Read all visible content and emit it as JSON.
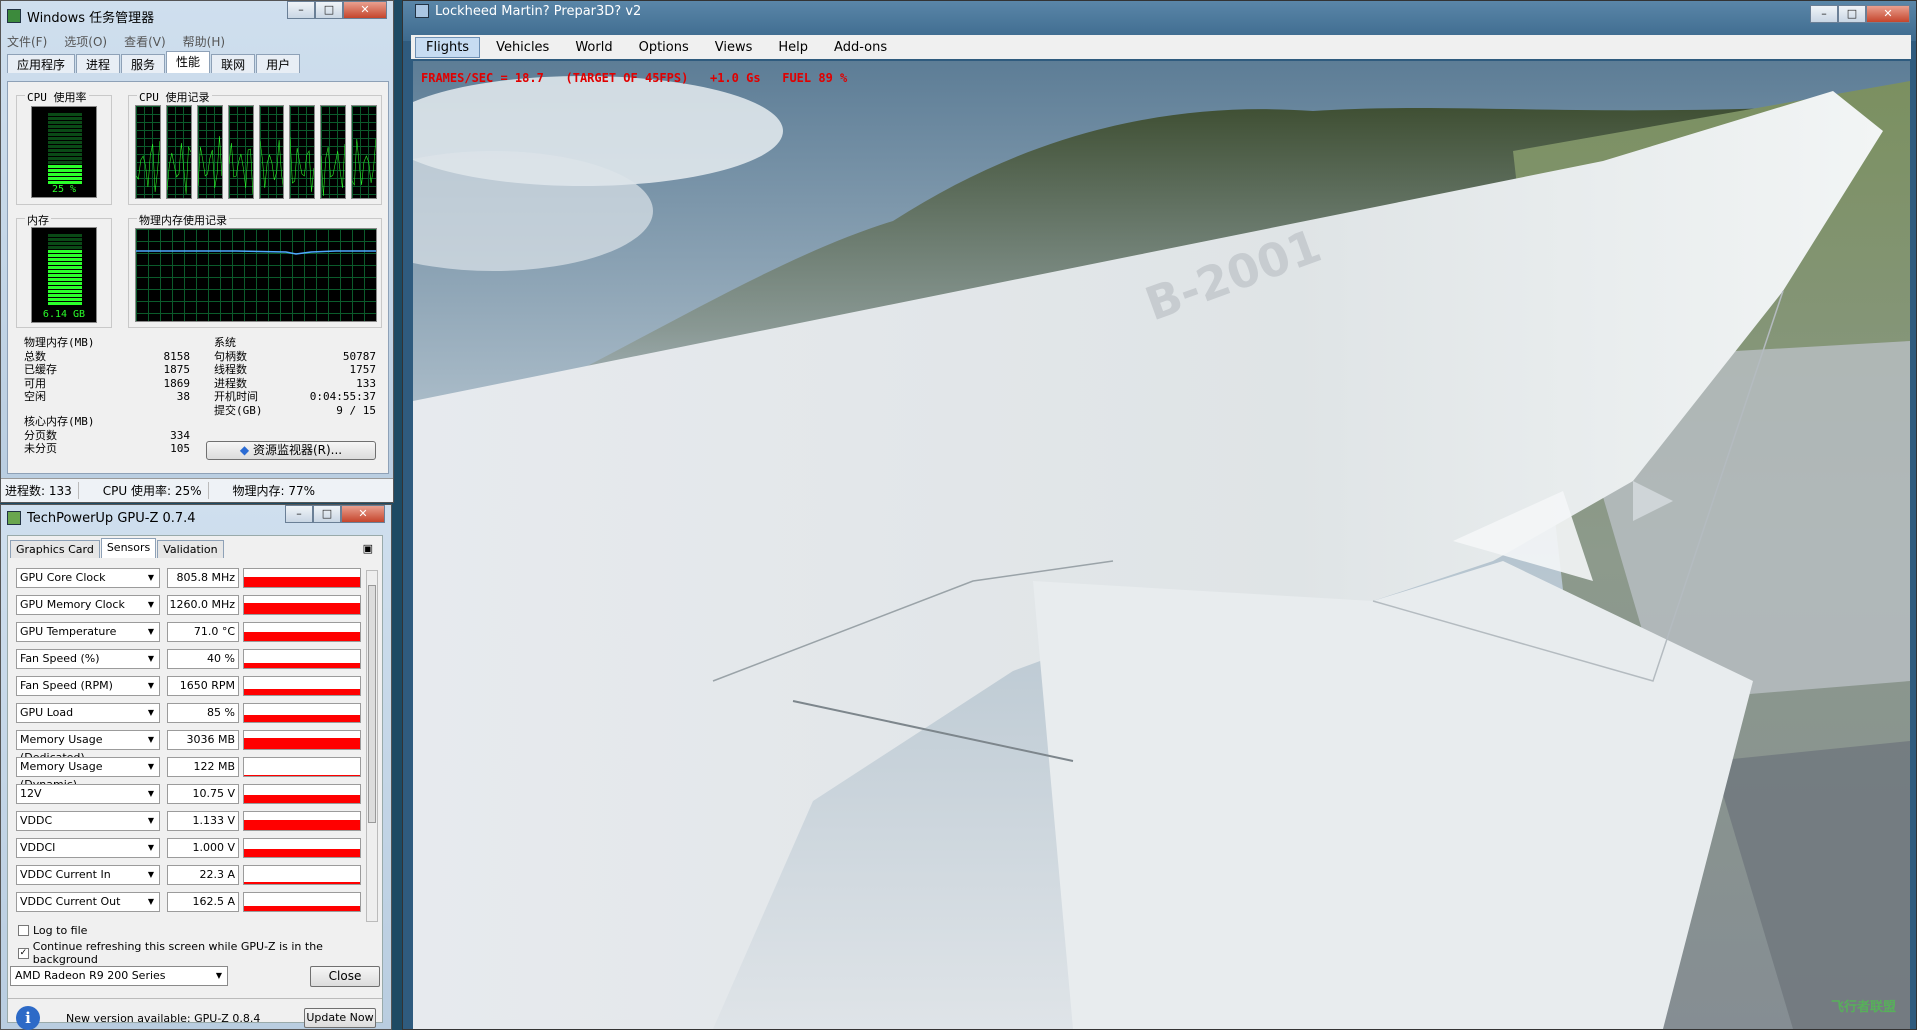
{
  "task_manager": {
    "title": "Windows 任务管理器",
    "menu": [
      "文件(F)",
      "选项(O)",
      "查看(V)",
      "帮助(H)"
    ],
    "tabs": [
      "应用程序",
      "进程",
      "服务",
      "性能",
      "联网",
      "用户"
    ],
    "active_tab": "性能",
    "cpu_usage_label": "CPU 使用率",
    "cpu_usage_value": "25 %",
    "cpu_history_label": "CPU 使用记录",
    "memory_label": "内存",
    "memory_value": "6.14 GB",
    "memory_history_label": "物理内存使用记录",
    "physical_memory": {
      "title": "物理内存(MB)",
      "rows": [
        {
          "label": "总数",
          "value": "8158"
        },
        {
          "label": "已缓存",
          "value": "1875"
        },
        {
          "label": "可用",
          "value": "1869"
        },
        {
          "label": "空闲",
          "value": "38"
        }
      ]
    },
    "kernel_memory": {
      "title": "核心内存(MB)",
      "rows": [
        {
          "label": "分页数",
          "value": "334"
        },
        {
          "label": "未分页",
          "value": "105"
        }
      ]
    },
    "system": {
      "title": "系统",
      "rows": [
        {
          "label": "句柄数",
          "value": "50787"
        },
        {
          "label": "线程数",
          "value": "1757"
        },
        {
          "label": "进程数",
          "value": "133"
        },
        {
          "label": "开机时间",
          "value": "0:04:55:37"
        },
        {
          "label": "提交(GB)",
          "value": "9 / 15"
        }
      ]
    },
    "resource_monitor_button": "资源监视器(R)...",
    "status": {
      "processes": "进程数: 133",
      "cpu": "CPU 使用率: 25%",
      "memory": "物理内存: 77%"
    }
  },
  "gpuz": {
    "title": "TechPowerUp GPU-Z 0.7.4",
    "tabs": [
      "Graphics Card",
      "Sensors",
      "Validation"
    ],
    "active_tab": "Sensors",
    "sensors": [
      {
        "name": "GPU Core Clock",
        "value": "805.8 MHz",
        "level": 0.55
      },
      {
        "name": "GPU Memory Clock",
        "value": "1260.0 MHz",
        "level": 0.6
      },
      {
        "name": "GPU Temperature",
        "value": "71.0 °C",
        "level": 0.5
      },
      {
        "name": "Fan Speed (%)",
        "value": "40 %",
        "level": 0.3
      },
      {
        "name": "Fan Speed (RPM)",
        "value": "1650 RPM",
        "level": 0.35
      },
      {
        "name": "GPU Load",
        "value": "85 %",
        "level": 0.4
      },
      {
        "name": "Memory Usage (Dedicated)",
        "value": "3036 MB",
        "level": 0.6
      },
      {
        "name": "Memory Usage (Dynamic)",
        "value": "122 MB",
        "level": 0.05
      },
      {
        "name": "12V",
        "value": "10.75 V",
        "level": 0.45
      },
      {
        "name": "VDDC",
        "value": "1.133 V",
        "level": 0.55
      },
      {
        "name": "VDDCI",
        "value": "1.000 V",
        "level": 0.45
      },
      {
        "name": "VDDC Current In",
        "value": "22.3 A",
        "level": 0.1
      },
      {
        "name": "VDDC Current Out",
        "value": "162.5 A",
        "level": 0.3
      }
    ],
    "log_to_file": "Log to file",
    "continue_refresh": "Continue refreshing this screen while GPU-Z is in the background",
    "gpu_select": "AMD Radeon R9 200 Series",
    "close_button": "Close",
    "update_text": "New version available: GPU-Z 0.8.4",
    "update_button": "Update Now"
  },
  "p3d": {
    "title": "Lockheed Martin? Prepar3D? v2",
    "menu": [
      "Flights",
      "Vehicles",
      "World",
      "Options",
      "Views",
      "Help",
      "Add-ons"
    ],
    "active_menu": "Flights",
    "hud": "FRAMES/SEC = 18.7   (TARGET OF 45FPS)   +1.0 Gs   FUEL 89 %",
    "registration": "B-2001",
    "watermark": "飞行者联盟"
  }
}
